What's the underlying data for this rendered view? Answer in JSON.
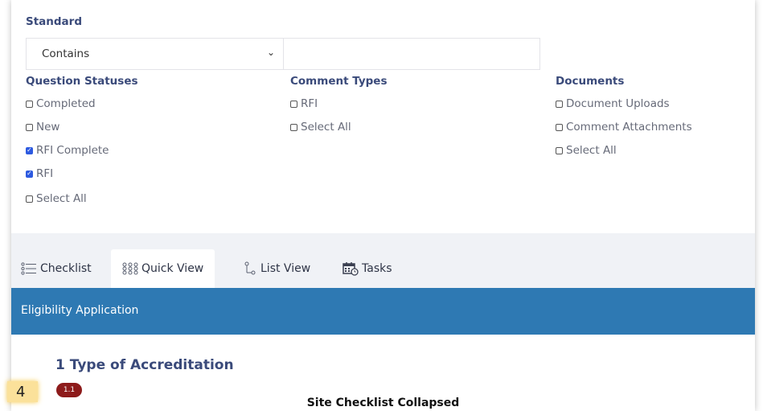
{
  "filters": {
    "standard_label": "Standard",
    "match_select": {
      "value": "Contains"
    },
    "text_value": "",
    "question_statuses": {
      "label": "Question Statuses",
      "items": [
        {
          "label": "Completed",
          "checked": false
        },
        {
          "label": "New",
          "checked": false
        },
        {
          "label": "RFI Complete",
          "checked": true
        },
        {
          "label": "RFI",
          "checked": true
        },
        {
          "label": "Select All",
          "checked": false
        }
      ]
    },
    "comment_types": {
      "label": "Comment Types",
      "items": [
        {
          "label": "RFI",
          "checked": false
        },
        {
          "label": "Select All",
          "checked": false
        }
      ]
    },
    "documents": {
      "label": "Documents",
      "items": [
        {
          "label": "Document Uploads",
          "checked": false
        },
        {
          "label": "Comment Attachments",
          "checked": false
        },
        {
          "label": "Select All",
          "checked": false
        }
      ]
    }
  },
  "tabs": [
    {
      "label": "Checklist",
      "icon": "checklist-icon",
      "active": false
    },
    {
      "label": "Quick View",
      "icon": "grid-dots-icon",
      "active": true
    },
    {
      "label": "List View",
      "icon": "tree-list-icon",
      "active": false
    },
    {
      "label": "Tasks",
      "icon": "calendar-clock-icon",
      "active": false
    }
  ],
  "header": {
    "title": "Eligibility Application"
  },
  "section": {
    "title": "1 Type of Accreditation"
  },
  "annotation": {
    "number": "4"
  },
  "badge": {
    "label": "1.1"
  },
  "caption": "Site Checklist Collapsed",
  "colors": {
    "accent_blue": "#2e79b3",
    "label_navy": "#3a4a7a",
    "badge_red": "#8d1b1b",
    "highlight_yellow": "#fbe19a",
    "checkbox_blue": "#2d5ae0"
  }
}
